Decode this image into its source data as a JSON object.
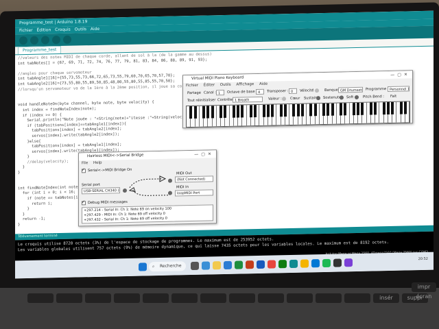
{
  "ide": {
    "title": "Programme_test | Arduino 1.8.19",
    "menu": "Fichier Édition Croquis Outils Aide",
    "tab": "Programme_test",
    "code_lines": [
      "//valeurs des notes MIDI de chaque corde, allant de sol à la (de la gamme au dessus)",
      "int tabNotes[] = {67, 69, 71, 72, 74, 76, 77, 79, 81, 83, 84, 86, 88, 89, 91, 93};",
      "",
      "//angles pour chaque servomoteur",
      "int tabAngle1[16]={55,73,55,73,66,72,65,73,55,79,60,70,65,70,57,70};",
      "int tabAngle2[16]={73,55,80,55,89,50,85,48,80,55,80,55,85,55,70,50};",
      "//lorsqu'un servomoteur va de la 1ère à la 2ème position, il joue sa corde",
      "",
      "",
      "void handleNoteOn(byte channel, byte note, byte velocity) {",
      "  int index = findNoteIndex(note);",
      "  if (index >= 0) {",
      "    Serial.println(\"Note jouée : \"+String(note)+\"itesse :\"+String(velocity));",
      "    if (tabPositions[index]==tabAngle1[index]){",
      "      tabPositions[index] = tabAngle2[index];",
      "      servos[index].write(tabAngle2[index]);",
      "    }else{",
      "      tabPositions[index] = tabAngle1[index];",
      "      servos[index].write(tabAngle1[index]);",
      "    }",
      "    //delay(velocity);",
      "  }",
      "}",
      "",
      "",
      "int findNoteIndex(int note) {",
      "  for (int i = 0; i < 16; i++) {",
      "    if (note == tabNotes[i]) {",
      "      return i;",
      "    }",
      "  }",
      "  return -1;",
      "}"
    ],
    "status": "Téléversement terminé",
    "console_lines": [
      "Le croquis utilise 8720 octets (3%) de l'espace de stockage de programmes. Le maximum est de 253952 octets.",
      "Les variables globales utilisent 757 octets (9%) de mémoire dynamique, ce qui laisse 7435 octets pour les variables locales. Le maximum est de 8192 octets."
    ],
    "board": "Arduino Mega or Mega 2560, ATmega2560 (Mega 2560) sur COM3"
  },
  "piano_window": {
    "title": "Virtual MIDI Piano Keyboard",
    "menu": "Fichier Éditer Outils Affichage Aide",
    "labels": {
      "partage": "Partage",
      "canal": "Canal :",
      "octave": "Octave de base :",
      "transpose": "Transposer :",
      "velocite": "Vélocité :",
      "banque": "Banque :",
      "programme": "Programme :",
      "tout": "Tout réinitialiser",
      "controle": "Contrôle :",
      "valeur": "Valeur :",
      "coeur": "Cœur",
      "sustain": "Sustain",
      "sostenuto": "Sostenuto",
      "soft": "Soft",
      "pitchbend": "Pitch Bend :",
      "fait": "Fait"
    },
    "values": {
      "canal": "1",
      "octave": "4",
      "transpose": "0",
      "banque": "GM Drumsets",
      "programme": "Personnel 1",
      "controle": "1 Breath"
    },
    "white_key_count": 52
  },
  "bridge_window": {
    "title": "Hairless MIDI<->Serial Bridge",
    "menu": "File Help",
    "bridge_on_label": "Serial<->MIDI Bridge On",
    "serial_port_label": "Serial port",
    "serial_port_value": "USB-SERIAL CH340 (COM3)",
    "midi_out_label": "MIDI Out",
    "midi_out_value": "(Not Connected)",
    "midi_in_label": "MIDI In",
    "midi_in_value": "loopMIDI Port",
    "debug_label": "Debug MIDI messages",
    "log": [
      "+297.214 - Serial In: Ch 1: Note 69 on velocity 100",
      "+297.429 - MIDI In: Ch 1: Note 69 off velocity 0",
      "+297.432 - Serial In: Ch 1: Note 69 off velocity 0"
    ]
  },
  "taskbar": {
    "search_label": "Recherche",
    "clock": "20:52"
  },
  "keyboard": {
    "labels": [
      "impr écran",
      "insér",
      "suppr"
    ]
  }
}
